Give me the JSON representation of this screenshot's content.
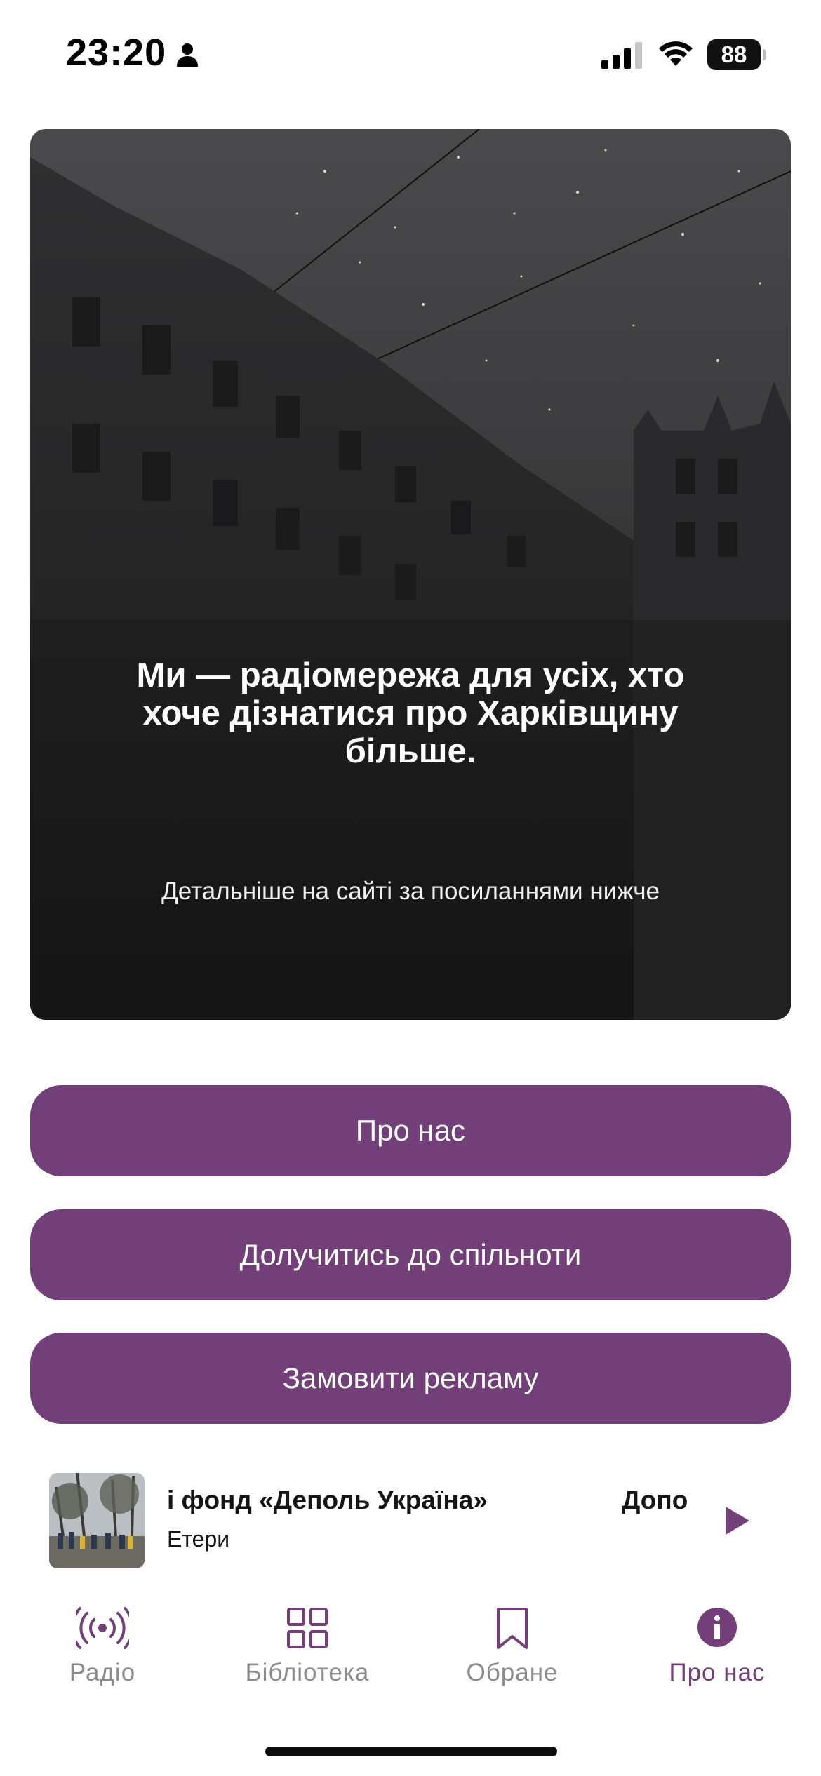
{
  "status_bar": {
    "time": "23:20",
    "battery": "88",
    "icons": [
      "person-icon",
      "signal-icon",
      "wifi-icon",
      "battery-icon"
    ]
  },
  "hero": {
    "title": "Ми — радіомережа для усіх, хто хоче дізнатися про Харківщину більше.",
    "subtitle": "Детальніше на сайті за посиланнями нижче",
    "background": "night-city-building-image"
  },
  "buttons": {
    "about": "Про нас",
    "join": "Долучитись до спільноти",
    "ads": "Замовити рекламу"
  },
  "player": {
    "title": "і фонд «Деполь Україна»",
    "title_next": "Допо",
    "subtitle": "Етери",
    "thumbnail": "people-under-trees-photo",
    "play_icon": "play-icon"
  },
  "tabs": [
    {
      "label": "Радіо",
      "icon": "radio-broadcast-icon",
      "active": false
    },
    {
      "label": "Бібліотека",
      "icon": "grid-icon",
      "active": false
    },
    {
      "label": "Обране",
      "icon": "bookmark-icon",
      "active": false
    },
    {
      "label": "Про нас",
      "icon": "info-icon",
      "active": true
    }
  ],
  "colors": {
    "accent": "#733f79",
    "tab_inactive": "#8d8a8f",
    "hero_dark": "#1b1b1c"
  }
}
